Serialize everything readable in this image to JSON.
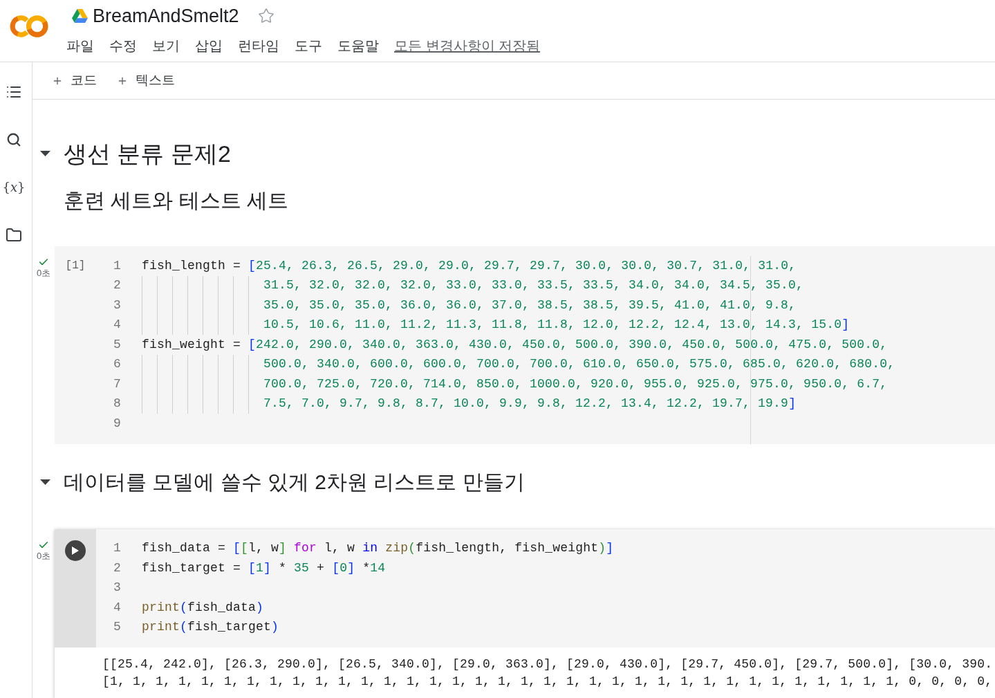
{
  "header": {
    "title": "BreamAndSmelt2",
    "starred": false,
    "menu": [
      "파일",
      "수정",
      "보기",
      "삽입",
      "런타임",
      "도구",
      "도움말"
    ],
    "save_status": "모든 변경사항이 저장됨"
  },
  "sidebar": {
    "items": [
      {
        "kind": "toc"
      },
      {
        "kind": "search"
      },
      {
        "kind": "variables",
        "glyph": "{*x*}"
      },
      {
        "kind": "files"
      }
    ]
  },
  "toolbar": {
    "buttons": [
      "코드",
      "텍스트"
    ]
  },
  "cells": [
    {
      "kind": "title",
      "text": "생선 분류 문제2",
      "expanded": true
    },
    {
      "kind": "subheading",
      "text": "훈련 세트와 테스트 세트"
    },
    {
      "kind": "code",
      "executed": true,
      "time": "0초",
      "focused": false,
      "execution_count": "[1]",
      "ruler": true,
      "lines": [
        {
          "number": "1",
          "guides": false,
          "tokens": [
            {
              "kind": "text",
              "text": "fish_length = "
            },
            {
              "kind": "bracket",
              "text": "["
            },
            {
              "kind": "number",
              "text": "25.4, 26.3, 26.5, 29.0, 29.0, 29.7, 29.7, 30.0, 30.0, 30.7, 31.0, 31.0,"
            }
          ]
        },
        {
          "number": "2",
          "guides": true,
          "tokens": [
            {
              "kind": "number",
              "text": "31.5, 32.0, 32.0, 32.0, 33.0, 33.0, 33.5, 33.5, 34.0, 34.0, 34.5, 35.0,"
            }
          ]
        },
        {
          "number": "3",
          "guides": true,
          "tokens": [
            {
              "kind": "number",
              "text": "35.0, 35.0, 35.0, 36.0, 36.0, 37.0, 38.5, 38.5, 39.5, 41.0, 41.0, 9.8,"
            }
          ]
        },
        {
          "number": "4",
          "guides": true,
          "tokens": [
            {
              "kind": "number",
              "text": "10.5, 10.6, 11.0, 11.2, 11.3, 11.8, 11.8, 12.0, 12.2, 12.4, 13.0, 14.3, 15.0"
            },
            {
              "kind": "bracket",
              "text": "]"
            }
          ]
        },
        {
          "number": "5",
          "guides": false,
          "tokens": [
            {
              "kind": "text",
              "text": "fish_weight = "
            },
            {
              "kind": "bracket",
              "text": "["
            },
            {
              "kind": "number",
              "text": "242.0, 290.0, 340.0, 363.0, 430.0, 450.0, 500.0, 390.0, 450.0, 500.0, 475.0, 500.0,"
            }
          ]
        },
        {
          "number": "6",
          "guides": true,
          "tokens": [
            {
              "kind": "number",
              "text": "500.0, 340.0, 600.0, 600.0, 700.0, 700.0, 610.0, 650.0, 575.0, 685.0, 620.0, 680.0,"
            }
          ]
        },
        {
          "number": "7",
          "guides": true,
          "tokens": [
            {
              "kind": "number",
              "text": "700.0, 725.0, 720.0, 714.0, 850.0, 1000.0, 920.0, 955.0, 925.0, 975.0, 950.0, 6.7,"
            }
          ]
        },
        {
          "number": "8",
          "guides": true,
          "tokens": [
            {
              "kind": "number",
              "text": "7.5, 7.0, 9.7, 9.8, 8.7, 10.0, 9.9, 9.8, 12.2, 13.4, 12.2, 19.7, 19.9"
            },
            {
              "kind": "bracket",
              "text": "]"
            }
          ]
        },
        {
          "number": "9",
          "guides": false
        }
      ]
    },
    {
      "kind": "heading",
      "text": "데이터를 모델에 쓸수 있게 2차원 리스트로 만들기",
      "expanded": true
    },
    {
      "kind": "code",
      "executed": true,
      "time": "0초",
      "focused": true,
      "ruler": false,
      "lines": [
        {
          "number": "1",
          "guides": false,
          "tokens": [
            {
              "kind": "text",
              "text": "fish_data = "
            },
            {
              "kind": "bracket",
              "text": "["
            },
            {
              "kind": "bracket2",
              "text": "["
            },
            {
              "kind": "text",
              "text": "l, w"
            },
            {
              "kind": "bracket2",
              "text": "]"
            },
            {
              "kind": "control",
              "text": " for"
            },
            {
              "kind": "text",
              "text": " l, w "
            },
            {
              "kind": "keyword",
              "text": "in"
            },
            {
              "kind": "function",
              "text": " zip"
            },
            {
              "kind": "bracket2",
              "text": "("
            },
            {
              "kind": "text",
              "text": "fish_length, fish_weight"
            },
            {
              "kind": "bracket2",
              "text": ")"
            },
            {
              "kind": "bracket",
              "text": "]"
            }
          ]
        },
        {
          "number": "2",
          "guides": false,
          "tokens": [
            {
              "kind": "text",
              "text": "fish_target = "
            },
            {
              "kind": "bracket",
              "text": "["
            },
            {
              "kind": "number",
              "text": "1"
            },
            {
              "kind": "bracket",
              "text": "]"
            },
            {
              "kind": "text",
              "text": " * "
            },
            {
              "kind": "number",
              "text": "35"
            },
            {
              "kind": "text",
              "text": " + "
            },
            {
              "kind": "bracket",
              "text": "["
            },
            {
              "kind": "number",
              "text": "0"
            },
            {
              "kind": "bracket",
              "text": "]"
            },
            {
              "kind": "text",
              "text": " *"
            },
            {
              "kind": "number",
              "text": "14"
            }
          ]
        },
        {
          "number": "3",
          "guides": false
        },
        {
          "number": "4",
          "guides": false,
          "tokens": [
            {
              "kind": "function",
              "text": "print"
            },
            {
              "kind": "bracket",
              "text": "("
            },
            {
              "kind": "text",
              "text": "fish_data"
            },
            {
              "kind": "bracket",
              "text": ")"
            }
          ]
        },
        {
          "number": "5",
          "guides": false,
          "tokens": [
            {
              "kind": "function",
              "text": "print"
            },
            {
              "kind": "bracket",
              "text": "("
            },
            {
              "kind": "text",
              "text": "fish_target"
            },
            {
              "kind": "bracket",
              "text": ")"
            }
          ]
        }
      ],
      "output": [
        "[[25.4, 242.0], [26.3, 290.0], [26.5, 340.0], [29.0, 363.0], [29.0, 430.0], [29.7, 450.0], [29.7, 500.0], [30.0, 390.",
        "[1, 1, 1, 1, 1, 1, 1, 1, 1, 1, 1, 1, 1, 1, 1, 1, 1, 1, 1, 1, 1, 1, 1, 1, 1, 1, 1, 1, 1, 1, 1, 1, 1, 1, 1, 0, 0, 0, 0,"
      ]
    }
  ]
}
